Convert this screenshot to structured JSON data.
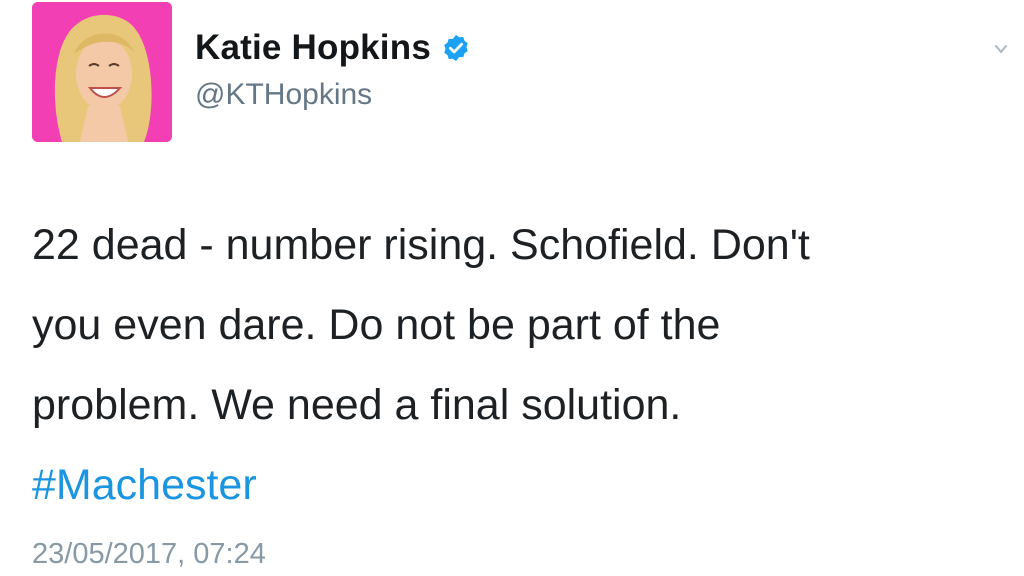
{
  "author": {
    "display_name": "Katie Hopkins",
    "handle": "@KTHopkins",
    "verified": true,
    "avatar_bg": "#f23fb4"
  },
  "tweet": {
    "text_line_1": "22 dead - number rising. Schofield. Don't",
    "text_line_2": "you even dare. Do not be part of the",
    "text_line_3": "problem. We need a final solution.",
    "hashtag": "#Machester",
    "timestamp": "23/05/2017, 07:24"
  },
  "colors": {
    "link": "#1b95e0",
    "verified": "#1da1f2",
    "secondary_text": "#657786"
  },
  "icons": {
    "verified": "verified-badge-icon",
    "menu": "chevron-down-icon"
  }
}
